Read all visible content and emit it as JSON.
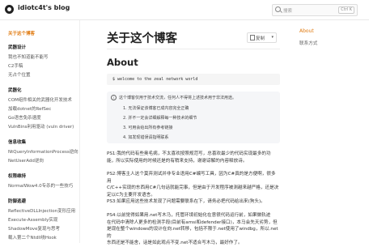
{
  "header": {
    "site_title": "idiotc4t's blog",
    "search_placeholder": "搜索",
    "search_shortcut": "Ctrl K"
  },
  "sidebar": {
    "items": [
      {
        "label": "关于这个博客",
        "type": "active"
      },
      {
        "label": "武器设计",
        "type": "head"
      },
      {
        "label": "我也不知道能不能写",
        "type": "item"
      },
      {
        "label": "C2手稿",
        "type": "item"
      },
      {
        "label": "无占个位置",
        "type": "item"
      },
      {
        "label": "武器化",
        "type": "head"
      },
      {
        "label": "COM组件相关的武器化开发技术",
        "type": "item"
      },
      {
        "label": "加载dotnet的RefSec",
        "type": "item"
      },
      {
        "label": "Go语言免杀速度",
        "type": "item"
      },
      {
        "label": "VulnBins利用驱动 (vuln driver)",
        "type": "item"
      },
      {
        "label": "信息收集",
        "type": "head"
      },
      {
        "label": "NtQueryInformationProcess逆向",
        "type": "item"
      },
      {
        "label": "NetUserAdd逆向",
        "type": "item"
      },
      {
        "label": "权限维持",
        "type": "head"
      },
      {
        "label": "NormalWow4.0专杀的一些技巧",
        "type": "item"
      },
      {
        "label": "防御逃避",
        "type": "head"
      },
      {
        "label": "ReflectiveDLLInjection变形应用",
        "type": "item"
      },
      {
        "label": "Execute-Assembly实现",
        "type": "item"
      },
      {
        "label": "ShadowMove复现与思考",
        "type": "item"
      },
      {
        "label": "载入第二个Ntdll绕Hook",
        "type": "item"
      }
    ]
  },
  "main": {
    "title": "关于这个博客",
    "copy_label": "复制",
    "section_title": "About",
    "code_line": "$ welcome to the zeal network world",
    "note_header": "这个博客仅用于技术交流，任何人不得将上述技术用于非法用途。",
    "note_items": [
      "1.  无法保证该博客已成内容完全正确",
      "2.  并不一定会详细解释每一种技术的细节",
      "3.  可用会给出所有参考链接",
      "4.  如发现错误请指明联系"
    ],
    "paragraphs": [
      [
        "PS1:我的代码有些奥毛病，不太喜欢按照规范写，总喜欢最少的代码实现最多的功",
        "能，所以实际使用的时候还是的有稍来支持，谢谢谅解的内容释放诗。"
      ],
      [
        "PS2:博客主人这个莫弃测试并非专业语用C#编写工具，因为C#真的是方便啊，很多用",
        "C/C++实现的东西用C#几句话就能完事，但是由于开发程序被测越来越严格，还是决",
        "定以C为主要开发语言。"
      ],
      [
        "PS3:如果应用这些技术发现了问题需要联系在下，请务必把代码给出来(狗头)。"
      ],
      [
        "PS4:以前觉得如果用.net写木马，托管环境初始化在意很代码运行前，如果做轨迹",
        "在代码中清除人更多的检测手段(目前有amsi和defender接口)，本马会先天劣势，但",
        "是现在整个windows的设计在向.net转移，包括不限于.net使用了windbg，所以.net的",
        "东西还是不能舍，话是如此观点不变.net不适合写木马，最好作了。"
      ]
    ]
  },
  "toc": {
    "title": "About",
    "items": [
      "联系方式"
    ]
  },
  "colors": {
    "accent": "#e07a10"
  }
}
